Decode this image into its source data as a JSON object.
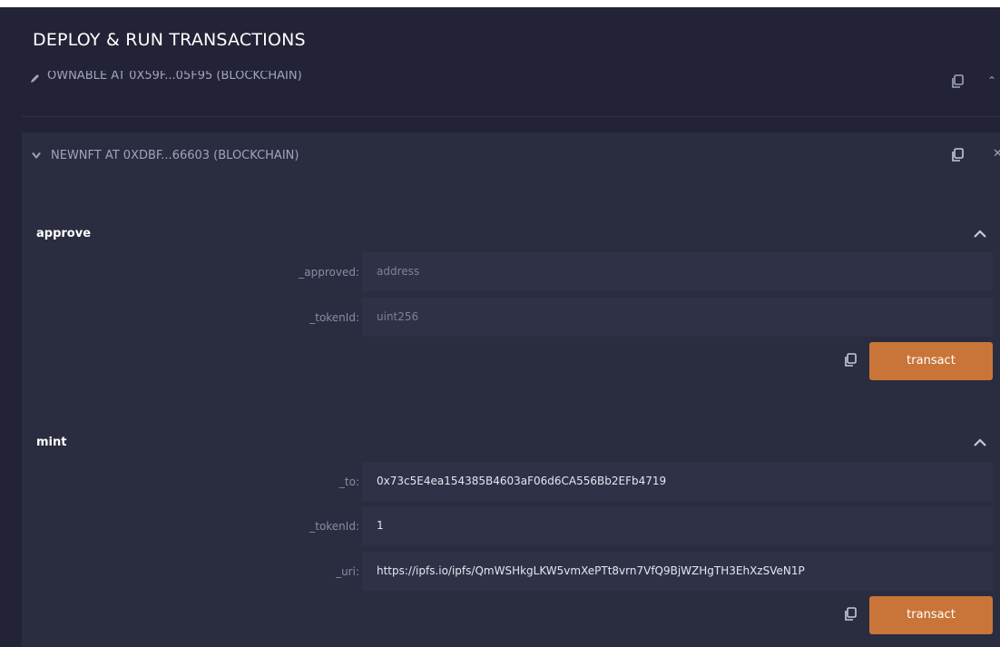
{
  "panel": {
    "title": "DEPLOY & RUN TRANSACTIONS"
  },
  "previous_instance": {
    "label": "OWNABLE AT 0X59F...05F95 (BLOCKCHAIN)"
  },
  "instance": {
    "label": "NEWNFT AT 0XDBF...66603 (BLOCKCHAIN)",
    "functions": [
      {
        "name": "approve",
        "params": [
          {
            "label": "_approved:",
            "value": "",
            "placeholder": "address"
          },
          {
            "label": "_tokenId:",
            "value": "",
            "placeholder": "uint256"
          }
        ],
        "button": "transact"
      },
      {
        "name": "mint",
        "params": [
          {
            "label": "_to:",
            "value": "0x73c5E4ea154385B4603aF06d6CA556Bb2EFb4719",
            "placeholder": ""
          },
          {
            "label": "_tokenId:",
            "value": "1",
            "placeholder": ""
          },
          {
            "label": "_uri:",
            "value": "https://ipfs.io/ipfs/QmWSHkgLKW5vmXePTt8vrn7VfQ9BjWZHgTH3EhXzSVeN1P",
            "placeholder": ""
          }
        ],
        "button": "transact"
      }
    ]
  },
  "colors": {
    "background": "#222336",
    "card": "#2a2c3f",
    "input": "#2f3147",
    "accent": "#c97539"
  },
  "icons": [
    "pencil-icon",
    "copy-icon",
    "chevron-down-icon",
    "chevron-up-icon",
    "close-icon"
  ]
}
